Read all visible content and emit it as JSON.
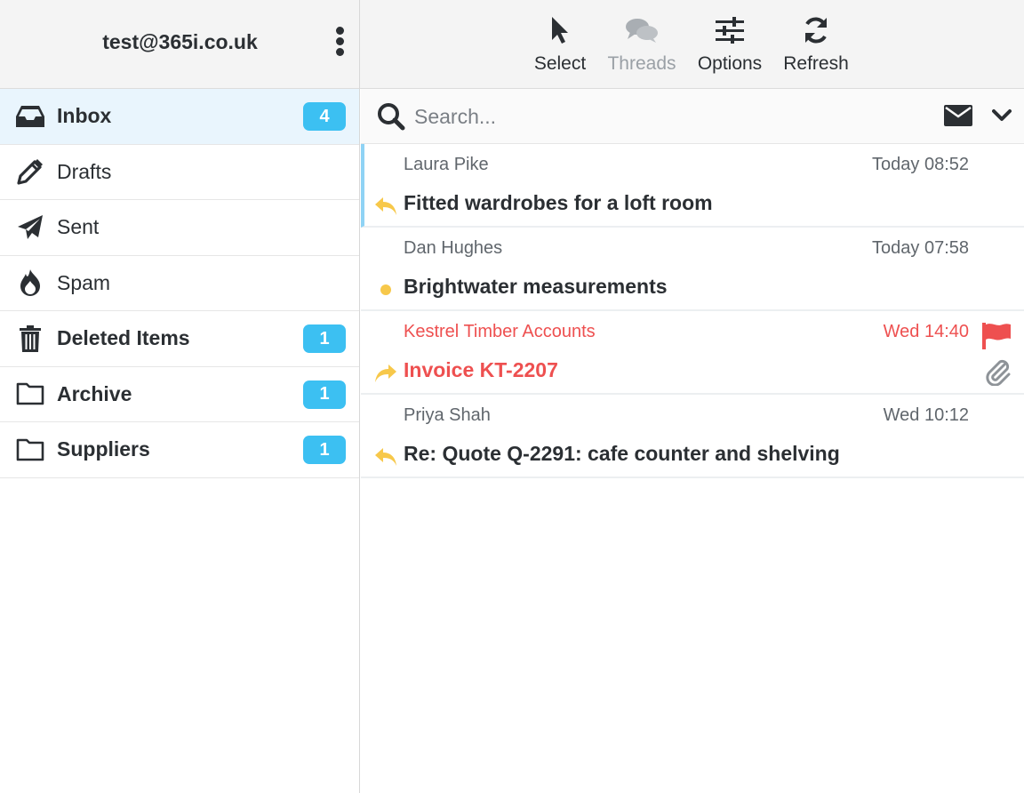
{
  "account": {
    "email": "test@365i.co.uk"
  },
  "toolbar": {
    "select_label": "Select",
    "threads_label": "Threads",
    "options_label": "Options",
    "refresh_label": "Refresh"
  },
  "sidebar": {
    "folders": [
      {
        "label": "Inbox",
        "count": "4",
        "icon": "inbox-icon",
        "bold": true,
        "active": true
      },
      {
        "label": "Drafts",
        "count": "",
        "icon": "pencil-icon",
        "bold": false
      },
      {
        "label": "Sent",
        "count": "",
        "icon": "paper-plane-icon",
        "bold": false
      },
      {
        "label": "Spam",
        "count": "",
        "icon": "fire-icon",
        "bold": false
      },
      {
        "label": "Deleted Items",
        "count": "1",
        "icon": "trash-icon",
        "bold": true
      },
      {
        "label": "Archive",
        "count": "1",
        "icon": "folder-icon",
        "bold": true
      },
      {
        "label": "Suppliers",
        "count": "1",
        "icon": "folder-icon",
        "bold": true
      }
    ]
  },
  "search": {
    "placeholder": "Search..."
  },
  "messages": [
    {
      "from": "Laura Pike",
      "time": "Today 08:52",
      "subject": "Fitted wardrobes for a loft room",
      "status": "replied"
    },
    {
      "from": "Dan Hughes",
      "time": "Today 07:58",
      "subject": "Brightwater measurements",
      "status": "unread"
    },
    {
      "from": "Kestrel Timber Accounts",
      "time": "Wed 14:40",
      "subject": "Invoice KT-2207",
      "status": "forwarded",
      "flagged": true,
      "attachment": true
    },
    {
      "from": "Priya Shah",
      "time": "Wed 10:12",
      "subject": "Re: Quote Q-2291: cafe counter and shelving",
      "status": "replied"
    }
  ],
  "colors": {
    "accent": "#3cc0f2",
    "active_bg": "#e9f5fd",
    "flag_red": "#ee5050",
    "status_yellow": "#f7c84a"
  }
}
